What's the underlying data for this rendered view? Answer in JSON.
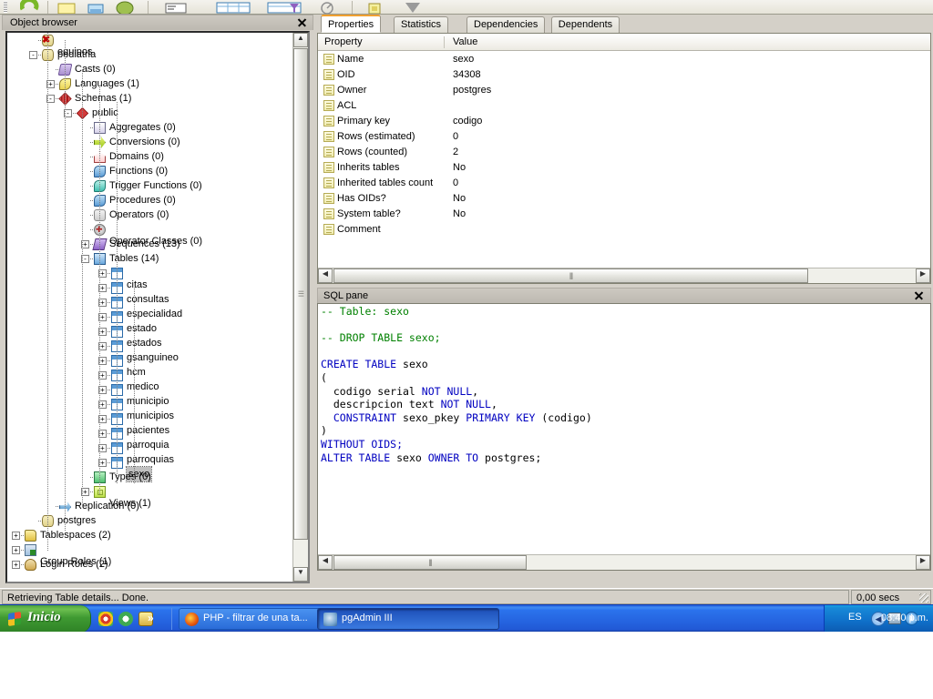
{
  "window": {
    "app_name": "pgAdmin III"
  },
  "toolbar": {
    "icons": [
      "refresh-icon",
      "query-icon",
      "view-data-icon",
      "filter-icon",
      "sql-icon",
      "grid-icon",
      "grid-filter-icon",
      "edit-icon",
      "square-icon",
      "dropdown-icon"
    ]
  },
  "object_browser": {
    "title": "Object browser",
    "close_label": "×",
    "tree": [
      {
        "label": "equipos",
        "depth": 2,
        "icon": "database-error-icon",
        "expander": "",
        "selected": false
      },
      {
        "label": "pediatria",
        "depth": 2,
        "icon": "database-icon",
        "expander": "-",
        "selected": false
      },
      {
        "label": "Casts (0)",
        "depth": 3,
        "icon": "casts-icon",
        "expander": "",
        "selected": false
      },
      {
        "label": "Languages (1)",
        "depth": 3,
        "icon": "languages-icon",
        "expander": "+",
        "selected": false
      },
      {
        "label": "Schemas (1)",
        "depth": 3,
        "icon": "schemas-icon",
        "expander": "-",
        "selected": false
      },
      {
        "label": "public",
        "depth": 4,
        "icon": "schema-icon",
        "expander": "-",
        "selected": false
      },
      {
        "label": "Aggregates (0)",
        "depth": 5,
        "icon": "aggregates-icon",
        "expander": "",
        "selected": false
      },
      {
        "label": "Conversions (0)",
        "depth": 5,
        "icon": "conversions-icon",
        "expander": "",
        "selected": false
      },
      {
        "label": "Domains (0)",
        "depth": 5,
        "icon": "domains-icon",
        "expander": "",
        "selected": false
      },
      {
        "label": "Functions (0)",
        "depth": 5,
        "icon": "functions-icon",
        "expander": "",
        "selected": false
      },
      {
        "label": "Trigger Functions (0)",
        "depth": 5,
        "icon": "trigger-functions-icon",
        "expander": "",
        "selected": false
      },
      {
        "label": "Procedures (0)",
        "depth": 5,
        "icon": "procedures-icon",
        "expander": "",
        "selected": false
      },
      {
        "label": "Operators (0)",
        "depth": 5,
        "icon": "operators-icon",
        "expander": "",
        "selected": false
      },
      {
        "label": "Operator Classes (0)",
        "depth": 5,
        "icon": "operator-classes-icon",
        "expander": "",
        "selected": false
      },
      {
        "label": "Sequences (13)",
        "depth": 5,
        "icon": "sequences-icon",
        "expander": "+",
        "selected": false
      },
      {
        "label": "Tables (14)",
        "depth": 5,
        "icon": "tables-icon",
        "expander": "-",
        "selected": false
      },
      {
        "label": "citas",
        "depth": 6,
        "icon": "table-icon",
        "expander": "+",
        "selected": false
      },
      {
        "label": "consultas",
        "depth": 6,
        "icon": "table-icon",
        "expander": "+",
        "selected": false
      },
      {
        "label": "especialidad",
        "depth": 6,
        "icon": "table-icon",
        "expander": "+",
        "selected": false
      },
      {
        "label": "estado",
        "depth": 6,
        "icon": "table-icon",
        "expander": "+",
        "selected": false
      },
      {
        "label": "estados",
        "depth": 6,
        "icon": "table-icon",
        "expander": "+",
        "selected": false
      },
      {
        "label": "gsanguineo",
        "depth": 6,
        "icon": "table-icon",
        "expander": "+",
        "selected": false
      },
      {
        "label": "hcm",
        "depth": 6,
        "icon": "table-icon",
        "expander": "+",
        "selected": false
      },
      {
        "label": "medico",
        "depth": 6,
        "icon": "table-icon",
        "expander": "+",
        "selected": false
      },
      {
        "label": "municipio",
        "depth": 6,
        "icon": "table-icon",
        "expander": "+",
        "selected": false
      },
      {
        "label": "municipios",
        "depth": 6,
        "icon": "table-icon",
        "expander": "+",
        "selected": false
      },
      {
        "label": "pacientes",
        "depth": 6,
        "icon": "table-icon",
        "expander": "+",
        "selected": false
      },
      {
        "label": "parroquia",
        "depth": 6,
        "icon": "table-icon",
        "expander": "+",
        "selected": false
      },
      {
        "label": "parroquias",
        "depth": 6,
        "icon": "table-icon",
        "expander": "+",
        "selected": false
      },
      {
        "label": "sexo",
        "depth": 6,
        "icon": "table-icon",
        "expander": "+",
        "selected": true
      },
      {
        "label": "Types (0)",
        "depth": 5,
        "icon": "types-icon",
        "expander": "",
        "selected": false
      },
      {
        "label": "Views (1)",
        "depth": 5,
        "icon": "views-icon",
        "expander": "+",
        "selected": false
      },
      {
        "label": "Replication (0)",
        "depth": 3,
        "icon": "replication-icon",
        "expander": "",
        "selected": false
      },
      {
        "label": "postgres",
        "depth": 2,
        "icon": "database-icon",
        "expander": "",
        "selected": false
      },
      {
        "label": "Tablespaces (2)",
        "depth": 1,
        "icon": "tablespaces-icon",
        "expander": "+",
        "selected": false
      },
      {
        "label": "Group Roles (1)",
        "depth": 1,
        "icon": "group-roles-icon",
        "expander": "+",
        "selected": false
      },
      {
        "label": "Login Roles (2)",
        "depth": 1,
        "icon": "login-roles-icon",
        "expander": "+",
        "selected": false
      }
    ]
  },
  "right_pane": {
    "tabs": [
      {
        "label": "Properties",
        "active": true
      },
      {
        "label": "Statistics",
        "active": false
      },
      {
        "label": "Dependencies",
        "active": false
      },
      {
        "label": "Dependents",
        "active": false
      }
    ],
    "properties": {
      "columns": [
        "Property",
        "Value"
      ],
      "rows": [
        {
          "property": "Name",
          "value": "sexo"
        },
        {
          "property": "OID",
          "value": "34308"
        },
        {
          "property": "Owner",
          "value": "postgres"
        },
        {
          "property": "ACL",
          "value": ""
        },
        {
          "property": "Primary key",
          "value": "codigo"
        },
        {
          "property": "Rows (estimated)",
          "value": "0"
        },
        {
          "property": "Rows (counted)",
          "value": "2"
        },
        {
          "property": "Inherits tables",
          "value": "No"
        },
        {
          "property": "Inherited tables count",
          "value": "0"
        },
        {
          "property": "Has OIDs?",
          "value": "No"
        },
        {
          "property": "System table?",
          "value": "No"
        },
        {
          "property": "Comment",
          "value": ""
        }
      ]
    }
  },
  "sql_pane": {
    "title": "SQL pane",
    "close_label": "×",
    "lines": [
      [
        {
          "t": "-- Table: sexo",
          "c": "cm"
        }
      ],
      [],
      [
        {
          "t": "-- DROP TABLE sexo;",
          "c": "cm"
        }
      ],
      [],
      [
        {
          "t": "CREATE TABLE ",
          "c": "kw"
        },
        {
          "t": "sexo",
          "c": "id"
        }
      ],
      [
        {
          "t": "(",
          "c": "id"
        }
      ],
      [
        {
          "t": "  codigo serial ",
          "c": "id"
        },
        {
          "t": "NOT NULL",
          "c": "kw"
        },
        {
          "t": ",",
          "c": "id"
        }
      ],
      [
        {
          "t": "  descripcion text ",
          "c": "id"
        },
        {
          "t": "NOT NULL",
          "c": "kw"
        },
        {
          "t": ",",
          "c": "id"
        }
      ],
      [
        {
          "t": "  CONSTRAINT ",
          "c": "kw"
        },
        {
          "t": "sexo_pkey ",
          "c": "id"
        },
        {
          "t": "PRIMARY KEY ",
          "c": "kw"
        },
        {
          "t": "(codigo)",
          "c": "id"
        }
      ],
      [
        {
          "t": ")",
          "c": "id"
        }
      ],
      [
        {
          "t": "WITHOUT OIDS;",
          "c": "kw"
        }
      ],
      [
        {
          "t": "ALTER TABLE ",
          "c": "kw"
        },
        {
          "t": "sexo ",
          "c": "id"
        },
        {
          "t": "OWNER TO ",
          "c": "kw"
        },
        {
          "t": "postgres;",
          "c": "id"
        }
      ]
    ]
  },
  "status_bar": {
    "message": "Retrieving Table details... Done.",
    "timing": "0,00 secs"
  },
  "taskbar": {
    "start_label": "Inicio",
    "quick_launch": [
      "chrome-icon",
      "opera-icon",
      "app-icon"
    ],
    "overflow_label": "»",
    "buttons": [
      {
        "label": "PHP - filtrar de una ta...",
        "icon": "firefox-icon",
        "active": false
      },
      {
        "label": "pgAdmin III",
        "icon": "pgadmin-icon",
        "active": true
      }
    ],
    "tray": {
      "language": "ES",
      "show_hidden_label": "◀",
      "icons": [
        "network-icon",
        "info-icon"
      ],
      "clock": "08:40 p.m."
    }
  }
}
